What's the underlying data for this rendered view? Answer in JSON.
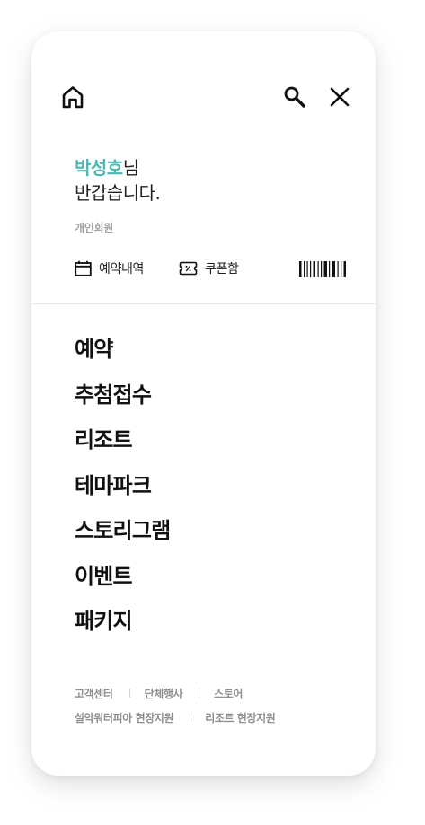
{
  "header": {
    "home_icon": "home-icon",
    "search_icon": "search-icon",
    "close_icon": "close-icon"
  },
  "user": {
    "name": "박성호",
    "honorific": "님",
    "greeting": "반갑습니다.",
    "member_type": "개인회원"
  },
  "quick_links": {
    "reservations": {
      "label": "예약내역",
      "icon": "calendar-icon"
    },
    "coupons": {
      "label": "쿠폰함",
      "icon": "coupon-icon"
    },
    "barcode": {
      "icon": "barcode-icon"
    }
  },
  "menu": {
    "items": [
      {
        "label": "예약"
      },
      {
        "label": "추첨접수"
      },
      {
        "label": "리조트"
      },
      {
        "label": "테마파크"
      },
      {
        "label": "스토리그램"
      },
      {
        "label": "이벤트"
      },
      {
        "label": "패키지"
      }
    ]
  },
  "footer": {
    "row1": [
      "고객센터",
      "단체행사",
      "스토어"
    ],
    "row2": [
      "설악워터피아 현장지원",
      "리조트 현장지원"
    ]
  },
  "colors": {
    "accent": "#4fb7b1",
    "text": "#111111",
    "muted": "#8f8f8f",
    "divider": "#e5e5e5"
  }
}
